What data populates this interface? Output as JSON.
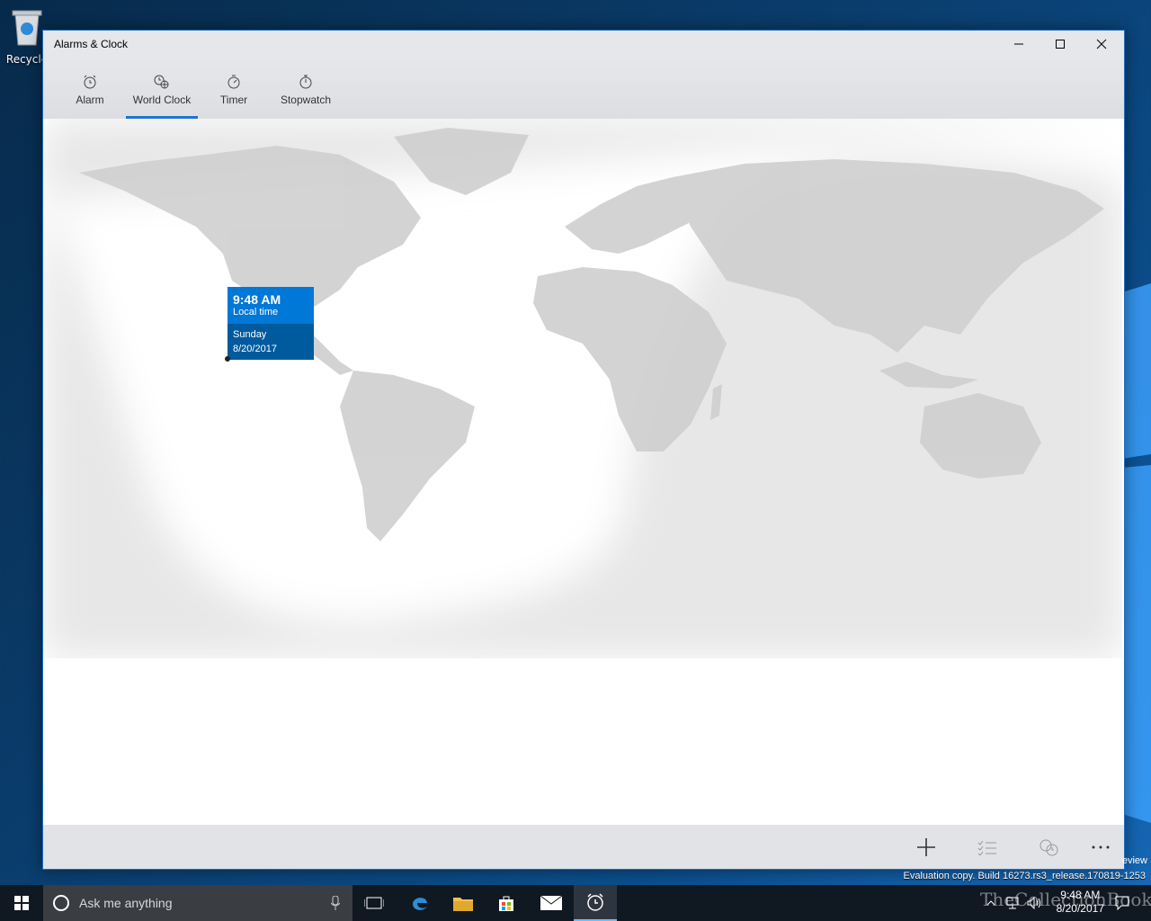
{
  "desktop": {
    "recycle_label": "Recycle"
  },
  "window": {
    "title": "Alarms & Clock",
    "controls": [
      "minimize-icon",
      "maximize-icon",
      "close-icon"
    ]
  },
  "tabs": [
    {
      "label": "Alarm",
      "icon": "alarm-icon"
    },
    {
      "label": "World Clock",
      "icon": "world-clock-icon",
      "active": true
    },
    {
      "label": "Timer",
      "icon": "timer-icon"
    },
    {
      "label": "Stopwatch",
      "icon": "stopwatch-icon"
    }
  ],
  "callout": {
    "time": "9:48 AM",
    "label": "Local time",
    "day": "Sunday",
    "date": "8/20/2017"
  },
  "commandbar": [
    "add-icon",
    "select-icon",
    "compare-icon",
    "more-icon"
  ],
  "watermark": {
    "line1": "Evaluation copy. Build 16273.rs3_release.170819-1253",
    "line0": "eview"
  },
  "taskbar": {
    "search_placeholder": "Ask me anything",
    "clock_time": "9:48 AM",
    "clock_date": "8/20/2017",
    "brand": "TheCollectionBook"
  }
}
